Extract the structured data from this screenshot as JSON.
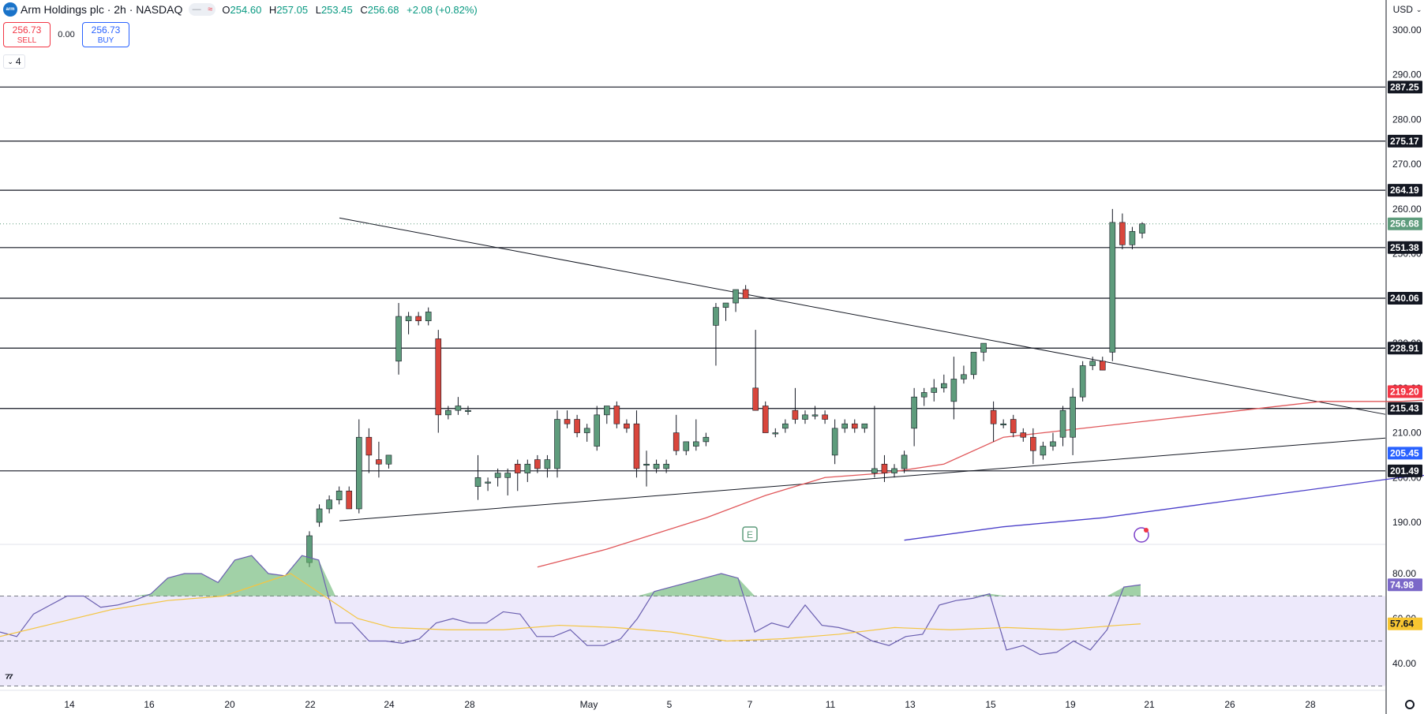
{
  "header": {
    "symbol": "Arm Holdings plc · 2h · NASDAQ",
    "logo_text": "arm",
    "toggle_a": "—",
    "toggle_b": "≈",
    "open_label": "O",
    "open": "254.60",
    "high_label": "H",
    "high": "257.05",
    "low_label": "L",
    "low": "253.45",
    "close_label": "C",
    "close": "256.68",
    "change": "+2.08 (+0.82%)"
  },
  "trade": {
    "sell_price": "256.73",
    "sell_label": "SELL",
    "spread": "0.00",
    "buy_price": "256.73",
    "buy_label": "BUY"
  },
  "indicator_toggle": "4",
  "currency": "USD",
  "colors": {
    "up": "#5e9c7c",
    "down": "#d9463c",
    "ma_fast": "#e0575a",
    "ma_slow": "#4b3fc9",
    "rsi_line": "#6a5fb0",
    "rsi_ma": "#f4c542",
    "rsi_band": "#ede9fb",
    "rsi_ob_fill": "#63b36c",
    "level_line": "#131722",
    "tag_green": "#5e9c7c",
    "tag_red": "#f23645",
    "tag_blue": "#2962ff",
    "tag_yellow": "#f7c531",
    "tag_purple": "#7b68c8"
  },
  "chart_data": {
    "type": "candlestick",
    "price_axis": {
      "min": 185,
      "max": 305,
      "ticks": [
        "190.00",
        "200.00",
        "210.00",
        "220.00",
        "230.00",
        "240.00",
        "250.00",
        "260.00",
        "270.00",
        "280.00",
        "290.00",
        "300.00"
      ]
    },
    "x_axis_labels": [
      {
        "label": "14",
        "date": "Apr 14"
      },
      {
        "label": "16",
        "date": "Apr 16"
      },
      {
        "label": "20",
        "date": "Apr 20"
      },
      {
        "label": "22",
        "date": "Apr 22"
      },
      {
        "label": "24",
        "date": "Apr 24"
      },
      {
        "label": "28",
        "date": "Apr 28"
      },
      {
        "label": "May",
        "date": "May 1"
      },
      {
        "label": "5",
        "date": "May 5"
      },
      {
        "label": "7",
        "date": "May 7"
      },
      {
        "label": "11",
        "date": "May 11"
      },
      {
        "label": "13",
        "date": "May 13"
      },
      {
        "label": "15",
        "date": "May 15"
      },
      {
        "label": "19",
        "date": "May 19"
      },
      {
        "label": "21",
        "date": "May 21"
      },
      {
        "label": "26",
        "date": "May 26"
      },
      {
        "label": "28",
        "date": "May 28"
      }
    ],
    "horizontal_levels": [
      {
        "value": 287.25,
        "label": "287.25"
      },
      {
        "value": 275.17,
        "label": "275.17"
      },
      {
        "value": 264.19,
        "label": "264.19"
      },
      {
        "value": 251.38,
        "label": "251.38"
      },
      {
        "value": 240.06,
        "label": "240.06"
      },
      {
        "value": 228.91,
        "label": "228.91"
      },
      {
        "value": 215.43,
        "label": "215.43"
      },
      {
        "value": 201.49,
        "label": "201.49"
      }
    ],
    "price_tags": [
      {
        "value": 256.68,
        "label": "256.68",
        "color": "green"
      },
      {
        "value": 219.2,
        "label": "219.20",
        "color": "red"
      },
      {
        "value": 205.45,
        "label": "205.45",
        "color": "blue"
      }
    ],
    "trendlines": [
      {
        "name": "descending-resistance",
        "x1_date": "Apr 22",
        "y1": 258.0,
        "x2_date": "May 21+",
        "y2": 215.0
      },
      {
        "name": "ascending-support",
        "x1_date": "Apr 22",
        "y1": 190.5,
        "x2_date": "May 21+",
        "y2": 209.0
      }
    ],
    "candles": [
      {
        "d": "Apr 21",
        "o": 181,
        "h": 188,
        "l": 180,
        "c": 187
      },
      {
        "d": "Apr 22",
        "o": 190,
        "h": 194,
        "l": 189,
        "c": 193
      },
      {
        "d": "Apr 22",
        "o": 193,
        "h": 196,
        "l": 192,
        "c": 195
      },
      {
        "d": "Apr 22",
        "o": 195,
        "h": 198,
        "l": 194,
        "c": 197
      },
      {
        "d": "Apr 23",
        "o": 197,
        "h": 198,
        "l": 193,
        "c": 193
      },
      {
        "d": "Apr 23",
        "o": 193,
        "h": 213,
        "l": 192,
        "c": 209
      },
      {
        "d": "Apr 23",
        "o": 209,
        "h": 211,
        "l": 201,
        "c": 205
      },
      {
        "d": "Apr 23",
        "o": 204,
        "h": 208,
        "l": 200,
        "c": 203
      },
      {
        "d": "Apr 24",
        "o": 203,
        "h": 205,
        "l": 202,
        "c": 205
      },
      {
        "d": "Apr 24",
        "o": 226,
        "h": 239,
        "l": 223,
        "c": 236
      },
      {
        "d": "Apr 24",
        "o": 235,
        "h": 237,
        "l": 232,
        "c": 236
      },
      {
        "d": "Apr 25",
        "o": 236,
        "h": 237,
        "l": 234,
        "c": 235
      },
      {
        "d": "Apr 25",
        "o": 235,
        "h": 238,
        "l": 234,
        "c": 237
      },
      {
        "d": "Apr 25",
        "o": 231,
        "h": 233,
        "l": 210,
        "c": 214
      },
      {
        "d": "Apr 25",
        "o": 214,
        "h": 216,
        "l": 213,
        "c": 215
      },
      {
        "d": "Apr 28",
        "o": 215,
        "h": 218,
        "l": 214,
        "c": 216
      },
      {
        "d": "Apr 28",
        "o": 215,
        "h": 216,
        "l": 214,
        "c": 215
      },
      {
        "d": "Apr 28",
        "o": 198,
        "h": 205,
        "l": 195,
        "c": 200
      },
      {
        "d": "Apr 28",
        "o": 199,
        "h": 200,
        "l": 197,
        "c": 199
      },
      {
        "d": "Apr 29",
        "o": 200,
        "h": 202,
        "l": 198,
        "c": 201
      },
      {
        "d": "Apr 29",
        "o": 200,
        "h": 202,
        "l": 196,
        "c": 201
      },
      {
        "d": "Apr 29",
        "o": 203,
        "h": 204,
        "l": 197,
        "c": 201
      },
      {
        "d": "Apr 30",
        "o": 201,
        "h": 204,
        "l": 199,
        "c": 203
      },
      {
        "d": "Apr 30",
        "o": 204,
        "h": 205,
        "l": 201,
        "c": 202
      },
      {
        "d": "Apr 30",
        "o": 202,
        "h": 205,
        "l": 200,
        "c": 204
      },
      {
        "d": "May 1",
        "o": 202,
        "h": 215,
        "l": 200,
        "c": 213
      },
      {
        "d": "May 1",
        "o": 213,
        "h": 215,
        "l": 211,
        "c": 212
      },
      {
        "d": "May 1",
        "o": 213,
        "h": 214,
        "l": 209,
        "c": 210
      },
      {
        "d": "May 2",
        "o": 210,
        "h": 212,
        "l": 208,
        "c": 211
      },
      {
        "d": "May 2",
        "o": 207,
        "h": 216,
        "l": 206,
        "c": 214
      },
      {
        "d": "May 2",
        "o": 214,
        "h": 215,
        "l": 212,
        "c": 216
      },
      {
        "d": "May 2",
        "o": 216,
        "h": 217,
        "l": 211,
        "c": 212
      },
      {
        "d": "May 5",
        "o": 212,
        "h": 213,
        "l": 210,
        "c": 211
      },
      {
        "d": "May 5",
        "o": 212,
        "h": 215,
        "l": 200,
        "c": 202
      },
      {
        "d": "May 5",
        "o": 203,
        "h": 206,
        "l": 198,
        "c": 203
      },
      {
        "d": "May 5",
        "o": 202,
        "h": 204,
        "l": 201,
        "c": 203
      },
      {
        "d": "May 6",
        "o": 202,
        "h": 204,
        "l": 201,
        "c": 203
      },
      {
        "d": "May 6",
        "o": 210,
        "h": 214,
        "l": 205,
        "c": 206
      },
      {
        "d": "May 6",
        "o": 206,
        "h": 208,
        "l": 205,
        "c": 208
      },
      {
        "d": "May 6",
        "o": 207,
        "h": 213,
        "l": 206,
        "c": 208
      },
      {
        "d": "May 6",
        "o": 208,
        "h": 210,
        "l": 207,
        "c": 209
      },
      {
        "d": "May 7",
        "o": 234,
        "h": 239,
        "l": 225,
        "c": 238
      },
      {
        "d": "May 7",
        "o": 238,
        "h": 239,
        "l": 235,
        "c": 239
      },
      {
        "d": "May 7",
        "o": 239,
        "h": 241,
        "l": 237,
        "c": 242
      },
      {
        "d": "May 7",
        "o": 242,
        "h": 243,
        "l": 240,
        "c": 240
      },
      {
        "d": "May 8",
        "o": 220,
        "h": 233,
        "l": 215,
        "c": 215
      },
      {
        "d": "May 8",
        "o": 216,
        "h": 217,
        "l": 210,
        "c": 210
      },
      {
        "d": "May 8",
        "o": 210,
        "h": 211,
        "l": 209,
        "c": 210
      },
      {
        "d": "May 8",
        "o": 211,
        "h": 213,
        "l": 210,
        "c": 212
      },
      {
        "d": "May 9",
        "o": 215,
        "h": 220,
        "l": 212,
        "c": 213
      },
      {
        "d": "May 9",
        "o": 213,
        "h": 215,
        "l": 212,
        "c": 214
      },
      {
        "d": "May 9",
        "o": 214,
        "h": 216,
        "l": 213,
        "c": 214
      },
      {
        "d": "May 9",
        "o": 214,
        "h": 215,
        "l": 212,
        "c": 213
      },
      {
        "d": "May 12",
        "o": 205,
        "h": 213,
        "l": 203,
        "c": 211
      },
      {
        "d": "May 12",
        "o": 211,
        "h": 213,
        "l": 210,
        "c": 212
      },
      {
        "d": "May 12",
        "o": 212,
        "h": 213,
        "l": 210,
        "c": 211
      },
      {
        "d": "May 12",
        "o": 211,
        "h": 212,
        "l": 210,
        "c": 212
      },
      {
        "d": "May 12",
        "o": 201,
        "h": 216,
        "l": 200,
        "c": 202
      },
      {
        "d": "May 13",
        "o": 203,
        "h": 205,
        "l": 199,
        "c": 201
      },
      {
        "d": "May 13",
        "o": 201,
        "h": 203,
        "l": 200,
        "c": 202
      },
      {
        "d": "May 13",
        "o": 202,
        "h": 206,
        "l": 201,
        "c": 205
      },
      {
        "d": "May 13",
        "o": 211,
        "h": 220,
        "l": 207,
        "c": 218
      },
      {
        "d": "May 14",
        "o": 218,
        "h": 220,
        "l": 216,
        "c": 219
      },
      {
        "d": "May 14",
        "o": 219,
        "h": 222,
        "l": 217,
        "c": 220
      },
      {
        "d": "May 14",
        "o": 220,
        "h": 223,
        "l": 219,
        "c": 221
      },
      {
        "d": "May 14",
        "o": 217,
        "h": 227,
        "l": 213,
        "c": 222
      },
      {
        "d": "May 15",
        "o": 222,
        "h": 225,
        "l": 221,
        "c": 223
      },
      {
        "d": "May 15",
        "o": 223,
        "h": 227,
        "l": 222,
        "c": 228
      },
      {
        "d": "May 15",
        "o": 228,
        "h": 230,
        "l": 226,
        "c": 230
      },
      {
        "d": "May 16",
        "o": 215,
        "h": 217,
        "l": 208,
        "c": 212
      },
      {
        "d": "May 16",
        "o": 212,
        "h": 213,
        "l": 211,
        "c": 212
      },
      {
        "d": "May 16",
        "o": 213,
        "h": 214,
        "l": 209,
        "c": 210
      },
      {
        "d": "May 16",
        "o": 210,
        "h": 211,
        "l": 208,
        "c": 209
      },
      {
        "d": "May 16",
        "o": 209,
        "h": 211,
        "l": 203,
        "c": 206
      },
      {
        "d": "May 19",
        "o": 205,
        "h": 208,
        "l": 204,
        "c": 207
      },
      {
        "d": "May 19",
        "o": 207,
        "h": 210,
        "l": 206,
        "c": 208
      },
      {
        "d": "May 19",
        "o": 209,
        "h": 216,
        "l": 207,
        "c": 215
      },
      {
        "d": "May 19",
        "o": 209,
        "h": 220,
        "l": 205,
        "c": 218
      },
      {
        "d": "May 19",
        "o": 218,
        "h": 226,
        "l": 217,
        "c": 225
      },
      {
        "d": "May 20",
        "o": 225,
        "h": 227,
        "l": 224,
        "c": 226
      },
      {
        "d": "May 20",
        "o": 226,
        "h": 227,
        "l": 224,
        "c": 224
      },
      {
        "d": "May 20",
        "o": 228,
        "h": 260,
        "l": 226,
        "c": 257
      },
      {
        "d": "May 20",
        "o": 257,
        "h": 259,
        "l": 251,
        "c": 252
      },
      {
        "d": "May 21",
        "o": 252,
        "h": 256,
        "l": 251,
        "c": 255
      },
      {
        "d": "May 21",
        "o": 254.6,
        "h": 257.05,
        "l": 253.45,
        "c": 256.68
      }
    ],
    "ma_fast": {
      "name": "MA",
      "last": 219.2,
      "values": [
        [
          23,
          180
        ],
        [
          30,
          184
        ],
        [
          40,
          191
        ],
        [
          46,
          196
        ],
        [
          52,
          200
        ],
        [
          58,
          201
        ],
        [
          64,
          203
        ],
        [
          70,
          209
        ],
        [
          78,
          211
        ],
        [
          86,
          213
        ],
        [
          94,
          215
        ],
        [
          102,
          217
        ],
        [
          110,
          217
        ],
        [
          118,
          218
        ],
        [
          130,
          222
        ]
      ]
    },
    "ma_slow": {
      "name": "MA",
      "last": 205.45,
      "values": [
        [
          60,
          186
        ],
        [
          70,
          189
        ],
        [
          80,
          191
        ],
        [
          90,
          194
        ],
        [
          100,
          197
        ],
        [
          110,
          200
        ],
        [
          120,
          202
        ],
        [
          125,
          203
        ],
        [
          130,
          205.45
        ]
      ]
    },
    "rsi": {
      "range": [
        25,
        90
      ],
      "ticks": [
        "40.00",
        "60.00",
        "80.00"
      ],
      "upper_band": 70,
      "lower_band": 30,
      "mid_line": 50,
      "last": 74.98,
      "ma_last": 57.64,
      "values": [
        [
          0,
          54
        ],
        [
          3,
          52
        ],
        [
          6,
          62
        ],
        [
          9,
          66
        ],
        [
          12,
          70
        ],
        [
          15,
          70
        ],
        [
          18,
          65
        ],
        [
          21,
          66
        ],
        [
          24,
          68
        ],
        [
          27,
          71
        ],
        [
          30,
          78
        ],
        [
          33,
          80
        ],
        [
          36,
          80
        ],
        [
          39,
          76
        ],
        [
          42,
          86
        ],
        [
          45,
          88
        ],
        [
          48,
          80
        ],
        [
          51,
          79
        ],
        [
          54,
          88
        ],
        [
          57,
          86
        ],
        [
          60,
          58
        ],
        [
          63,
          58
        ],
        [
          66,
          50
        ],
        [
          69,
          50
        ],
        [
          72,
          49
        ],
        [
          75,
          51
        ],
        [
          78,
          58
        ],
        [
          81,
          60
        ],
        [
          84,
          58
        ],
        [
          87,
          58
        ],
        [
          90,
          63
        ],
        [
          93,
          62
        ],
        [
          96,
          52
        ],
        [
          99,
          52
        ],
        [
          102,
          55
        ],
        [
          105,
          48
        ],
        [
          108,
          48
        ],
        [
          111,
          51
        ],
        [
          114,
          60
        ],
        [
          117,
          72
        ],
        [
          120,
          74
        ],
        [
          123,
          76
        ],
        [
          126,
          78
        ],
        [
          129,
          80
        ],
        [
          132,
          78
        ],
        [
          135,
          54
        ],
        [
          138,
          58
        ],
        [
          141,
          56
        ],
        [
          144,
          66
        ],
        [
          147,
          57
        ],
        [
          150,
          56
        ],
        [
          153,
          54
        ],
        [
          156,
          50
        ],
        [
          159,
          48
        ],
        [
          162,
          52
        ],
        [
          165,
          53
        ],
        [
          168,
          66
        ],
        [
          171,
          68
        ],
        [
          174,
          69
        ],
        [
          177,
          71
        ],
        [
          180,
          46
        ],
        [
          183,
          48
        ],
        [
          186,
          44
        ],
        [
          189,
          45
        ],
        [
          192,
          50
        ],
        [
          195,
          46
        ],
        [
          198,
          55
        ],
        [
          201,
          74
        ],
        [
          204,
          75
        ]
      ],
      "ma_values": [
        [
          0,
          52
        ],
        [
          10,
          58
        ],
        [
          20,
          64
        ],
        [
          30,
          68
        ],
        [
          40,
          70
        ],
        [
          46,
          75
        ],
        [
          52,
          80
        ],
        [
          58,
          70
        ],
        [
          64,
          60
        ],
        [
          70,
          56
        ],
        [
          80,
          55
        ],
        [
          90,
          55
        ],
        [
          100,
          57
        ],
        [
          110,
          56
        ],
        [
          120,
          54
        ],
        [
          130,
          50
        ],
        [
          140,
          51
        ],
        [
          150,
          53
        ],
        [
          160,
          56
        ],
        [
          170,
          55
        ],
        [
          180,
          56
        ],
        [
          190,
          55
        ],
        [
          200,
          57
        ],
        [
          204,
          57.64
        ]
      ]
    }
  }
}
